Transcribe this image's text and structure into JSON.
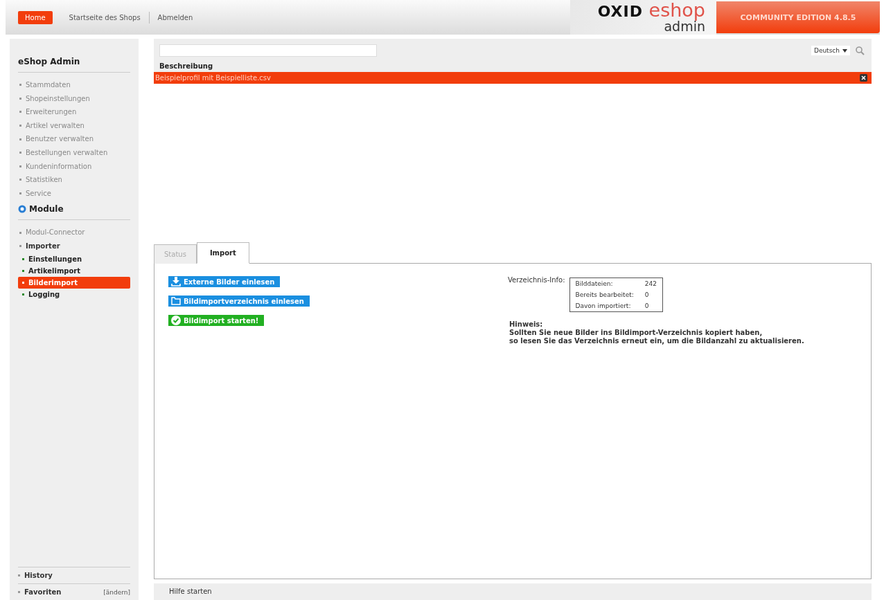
{
  "header": {
    "nav": [
      {
        "label": "Home",
        "selected": true
      },
      {
        "label": "Startseite des Shops",
        "selected": false
      },
      {
        "label": "Abmelden",
        "selected": false
      }
    ],
    "logo": {
      "brand": "OXID",
      "product": "eshop",
      "sub": "admin"
    },
    "edition": "COMMUNITY EDITION 4.8.5"
  },
  "sidebar": {
    "title": "eShop Admin",
    "items": [
      {
        "label": "Stammdaten",
        "selected": false,
        "expanded": false
      },
      {
        "label": "Shopeinstellungen",
        "selected": false,
        "expanded": false
      },
      {
        "label": "Erweiterungen",
        "selected": false,
        "expanded": false
      },
      {
        "label": "Artikel verwalten",
        "selected": false,
        "expanded": false
      },
      {
        "label": "Benutzer verwalten",
        "selected": false,
        "expanded": false
      },
      {
        "label": "Bestellungen verwalten",
        "selected": false,
        "expanded": false
      },
      {
        "label": "Kundeninformation",
        "selected": false,
        "expanded": false
      },
      {
        "label": "Statistiken",
        "selected": false,
        "expanded": false
      },
      {
        "label": "Service",
        "selected": false,
        "expanded": false
      }
    ],
    "module_title": "Module",
    "module_items": [
      {
        "label": "Modul-Connector",
        "selected": false,
        "expanded": false
      },
      {
        "label": "Importer",
        "selected": false,
        "expanded": true,
        "children": [
          {
            "label": "Einstellungen",
            "selected": false
          },
          {
            "label": "Artikelimport",
            "selected": false
          },
          {
            "label": "Bilderimport",
            "selected": true
          },
          {
            "label": "Logging",
            "selected": false
          }
        ]
      }
    ],
    "history": "History",
    "favorites": "Favoriten",
    "favorites_edit": "[ändern]"
  },
  "list": {
    "language": "Deutsch",
    "column": "Beschreibung",
    "rows": [
      {
        "label": "Beispielprofil mit Beispielliste.csv",
        "selected": true
      }
    ]
  },
  "tabs": [
    {
      "label": "Status",
      "selected": false
    },
    {
      "label": "Import",
      "selected": true
    }
  ],
  "actions": [
    {
      "label": "Externe Bilder einlesen",
      "kind": "download"
    },
    {
      "label": "Bildimportverzeichnis einlesen",
      "kind": "folder"
    },
    {
      "label": "Bildimport starten!",
      "kind": "start"
    }
  ],
  "info": {
    "label": "Verzeichnis-Info:",
    "rows": [
      {
        "name": "Bilddateien:",
        "value": "242"
      },
      {
        "name": "Bereits bearbeitet:",
        "value": "0"
      },
      {
        "name": "Davon importiert:",
        "value": "0"
      }
    ],
    "note_title": "Hinweis:",
    "note_lines": [
      "Sollten Sie neue Bilder ins Bildimport-Verzeichnis kopiert haben,",
      "so lesen Sie das Verzeichnis erneut ein, um die Bildanzahl zu aktualisieren."
    ]
  },
  "footer": {
    "help": "Hilfe starten"
  }
}
